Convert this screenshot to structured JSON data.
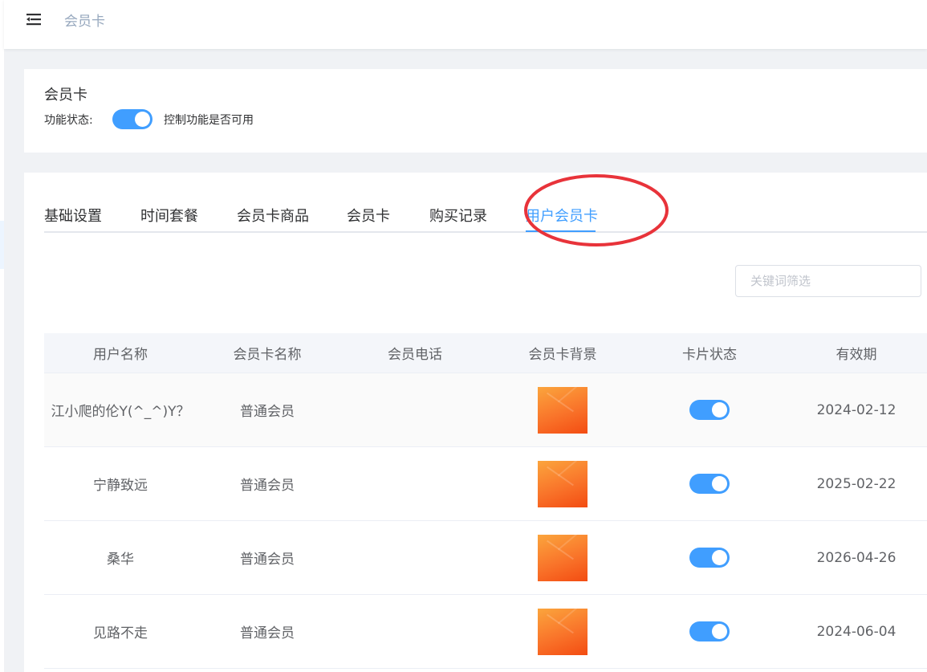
{
  "header": {
    "breadcrumb": "会员卡"
  },
  "feature": {
    "title": "会员卡",
    "status_label": "功能状态:",
    "status_on": true,
    "status_desc": "控制功能是否可用"
  },
  "tabs": [
    {
      "label": "基础设置",
      "active": false
    },
    {
      "label": "时间套餐",
      "active": false
    },
    {
      "label": "会员卡商品",
      "active": false
    },
    {
      "label": "会员卡",
      "active": false
    },
    {
      "label": "购买记录",
      "active": false
    },
    {
      "label": "用户会员卡",
      "active": true
    }
  ],
  "search": {
    "placeholder": "关键词筛选",
    "value": ""
  },
  "table": {
    "columns": [
      "用户名称",
      "会员卡名称",
      "会员电话",
      "会员卡背景",
      "卡片状态",
      "有效期"
    ],
    "rows": [
      {
        "user": "江小爬的伦Y(^_^)Y？",
        "card_name": "普通会员",
        "phone": "",
        "status_on": true,
        "expiry": "2024-02-12"
      },
      {
        "user": "宁静致远",
        "card_name": "普通会员",
        "phone": "",
        "status_on": true,
        "expiry": "2025-02-22"
      },
      {
        "user": "桑华",
        "card_name": "普通会员",
        "phone": "",
        "status_on": true,
        "expiry": "2026-04-26"
      },
      {
        "user": "见路不走",
        "card_name": "普通会员",
        "phone": "",
        "status_on": true,
        "expiry": "2024-06-04"
      }
    ]
  },
  "colors": {
    "accent": "#409eff",
    "annotation": "#e8333a",
    "card_gradient_start": "#fba53d",
    "card_gradient_end": "#f34c12"
  }
}
